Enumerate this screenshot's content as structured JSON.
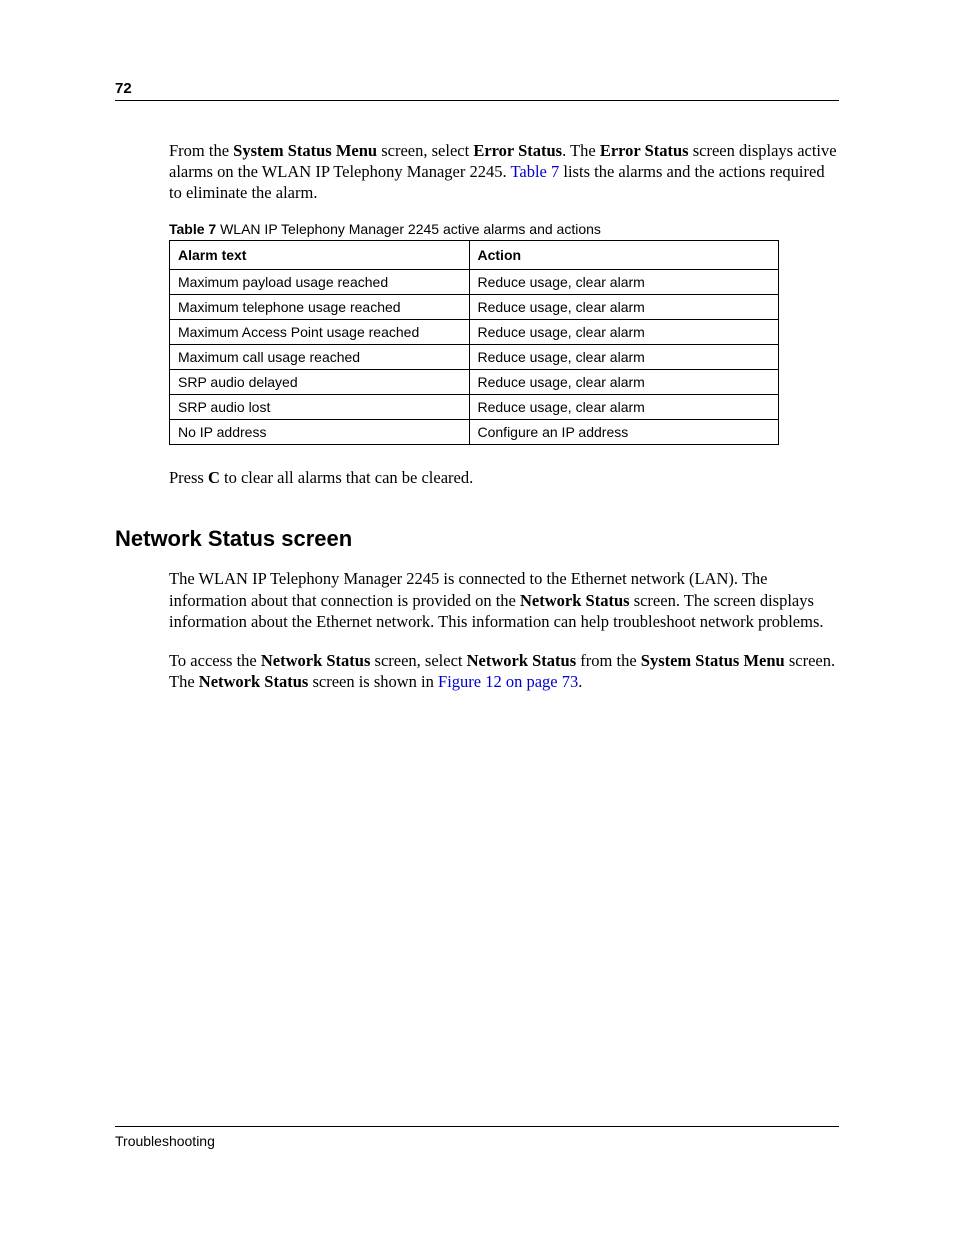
{
  "page_number": "72",
  "intro": {
    "t1": "From the ",
    "b1": "System Status Menu",
    "t2": " screen, select ",
    "b2": "Error Status",
    "t3": ". The ",
    "b3": "Error Status",
    "t4": " screen displays active alarms on the WLAN IP Telephony Manager 2245. ",
    "link1": "Table 7",
    "t5": " lists the alarms and the actions required to eliminate the alarm."
  },
  "table_caption": {
    "label": "Table 7",
    "text": "   WLAN IP Telephony Manager 2245 active alarms and actions"
  },
  "table": {
    "headers": {
      "col1": "Alarm text",
      "col2": "Action"
    },
    "rows": [
      {
        "alarm": "Maximum payload usage reached",
        "action": "Reduce usage, clear alarm"
      },
      {
        "alarm": "Maximum telephone usage reached",
        "action": "Reduce usage, clear alarm"
      },
      {
        "alarm": "Maximum Access Point usage reached",
        "action": "Reduce usage, clear alarm"
      },
      {
        "alarm": "Maximum call usage reached",
        "action": "Reduce usage, clear alarm"
      },
      {
        "alarm": "SRP audio delayed",
        "action": "Reduce usage, clear alarm"
      },
      {
        "alarm": "SRP audio lost",
        "action": "Reduce usage, clear alarm"
      },
      {
        "alarm": "No IP address",
        "action": "Configure an IP address"
      }
    ]
  },
  "press_c": {
    "t1": "Press ",
    "b1": "C",
    "t2": " to clear all alarms that can be cleared."
  },
  "section_heading": "Network Status screen",
  "net_para1": {
    "t1": "The WLAN IP Telephony Manager 2245 is connected to the Ethernet network (LAN). The information about that connection is provided on the ",
    "b1": "Network Status",
    "t2": " screen. The screen displays information about the Ethernet network. This information can help troubleshoot network problems."
  },
  "net_para2": {
    "t1": "To access the ",
    "b1": "Network Status",
    "t2": " screen, select ",
    "b2": "Network Status",
    "t3": " from the ",
    "b3": "System Status Menu",
    "t4": " screen. The ",
    "b4": "Network Status",
    "t5": " screen is shown in ",
    "link1": "Figure 12 on page 73",
    "t6": "."
  },
  "footer": "Troubleshooting"
}
